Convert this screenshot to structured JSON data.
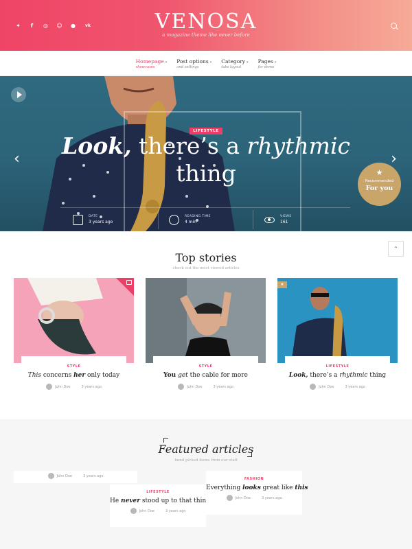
{
  "header": {
    "logo": "VENOSA",
    "tagline": "a magazine theme like never before",
    "social": [
      "twitter",
      "facebook",
      "instagram",
      "snapchat",
      "reddit",
      "vk"
    ]
  },
  "nav": [
    {
      "label": "Homepage",
      "sub": "showcases"
    },
    {
      "label": "Post options",
      "sub": "and settings"
    },
    {
      "label": "Category",
      "sub": "tabs layout"
    },
    {
      "label": "Pages",
      "sub": "for demo"
    }
  ],
  "hero": {
    "category": "LIFESTYLE",
    "title_bold": "Look,",
    "title_mid": " there’s a ",
    "title_italic": "rhythmic",
    "title_end": "thing",
    "meta": {
      "date_label": "DATE",
      "date_value": "3 years ago",
      "reading_label": "READING TIME",
      "reading_value": "4 min",
      "views_label": "VIEWS",
      "views_value": "161"
    },
    "recommended_top": "Recommended",
    "recommended_bottom": "For you"
  },
  "top_stories": {
    "title": "Top stories",
    "subtitle": "check out the most viewed articles",
    "cards": [
      {
        "category": "STYLE",
        "t1": "This",
        "t2": " concerns ",
        "t3": "her",
        "t4": " only today",
        "author": "John Doe",
        "time": "3 years ago"
      },
      {
        "category": "STYLE",
        "t1": "You",
        "t2": " get ",
        "t3": "the cable for more",
        "author": "John Doe",
        "time": "3 years ago"
      },
      {
        "category": "LIFESTYLE",
        "t1": "Look,",
        "t2": " there’s a ",
        "t3": "rhythmic",
        "t4": " thing",
        "author": "John Doe",
        "time": "3 years ago"
      }
    ]
  },
  "featured": {
    "title": "Featured articles",
    "subtitle": "hand picked items from our staff",
    "cards": [
      {
        "author": "John Doe",
        "time": "3 years ago"
      },
      {
        "category": "LIFESTYLE",
        "t1": "He ",
        "t2": "never",
        "t3": " stood up to that thing",
        "author": "John Doe",
        "time": "3 years ago"
      },
      {
        "category": "FASHION",
        "t1": "Everything ",
        "t2": "looks",
        "t3": " great like ",
        "t4": "this",
        "author": "John Doe",
        "time": "3 years ago"
      }
    ]
  },
  "colors": {
    "accent": "#ec3e66",
    "gold": "#c9a56a",
    "hero_bg": "#2c6379"
  }
}
